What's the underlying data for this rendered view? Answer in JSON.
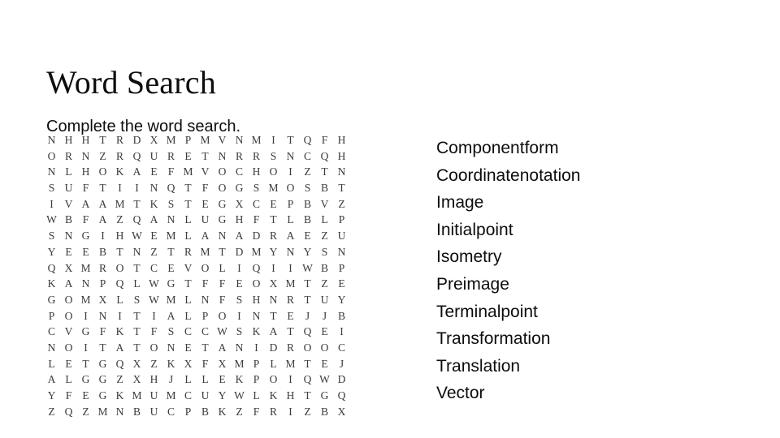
{
  "slide": {
    "title": "Word Search",
    "subtitle": "Complete the word search.",
    "background_color": "#ffffff",
    "text_color": "#0d0d0d",
    "grid_text_color": "#3b3b3b"
  },
  "puzzle": {
    "rows": 18,
    "columns": 18,
    "grid": [
      [
        "N",
        "H",
        "H",
        "T",
        "R",
        "D",
        "X",
        "M",
        "P",
        "M",
        "V",
        "N",
        "M",
        "I",
        "T",
        "Q",
        "F",
        "H"
      ],
      [
        "O",
        "R",
        "N",
        "Z",
        "R",
        "Q",
        "U",
        "R",
        "E",
        "T",
        "N",
        "R",
        "R",
        "S",
        "N",
        "C",
        "Q",
        "H"
      ],
      [
        "N",
        "L",
        "H",
        "O",
        "K",
        "A",
        "E",
        "F",
        "M",
        "V",
        "O",
        "C",
        "H",
        "O",
        "I",
        "Z",
        "T",
        "N"
      ],
      [
        "S",
        "U",
        "F",
        "T",
        "I",
        "I",
        "N",
        "Q",
        "T",
        "F",
        "O",
        "G",
        "S",
        "M",
        "O",
        "S",
        "B",
        "T"
      ],
      [
        "I",
        "V",
        "A",
        "A",
        "M",
        "T",
        "K",
        "S",
        "T",
        "E",
        "G",
        "X",
        "C",
        "E",
        "P",
        "B",
        "V",
        "Z"
      ],
      [
        "W",
        "B",
        "F",
        "A",
        "Z",
        "Q",
        "A",
        "N",
        "L",
        "U",
        "G",
        "H",
        "F",
        "T",
        "L",
        "B",
        "L",
        "P"
      ],
      [
        "S",
        "N",
        "G",
        "I",
        "H",
        "W",
        "E",
        "M",
        "L",
        "A",
        "N",
        "A",
        "D",
        "R",
        "A",
        "E",
        "Z",
        "U"
      ],
      [
        "Y",
        "E",
        "E",
        "B",
        "T",
        "N",
        "Z",
        "T",
        "R",
        "M",
        "T",
        "D",
        "M",
        "Y",
        "N",
        "Y",
        "S",
        "N"
      ],
      [
        "Q",
        "X",
        "M",
        "R",
        "O",
        "T",
        "C",
        "E",
        "V",
        "O",
        "L",
        "I",
        "Q",
        "I",
        "I",
        "W",
        "B",
        "P"
      ],
      [
        "K",
        "A",
        "N",
        "P",
        "Q",
        "L",
        "W",
        "G",
        "T",
        "F",
        "F",
        "E",
        "O",
        "X",
        "M",
        "T",
        "Z",
        "E"
      ],
      [
        "G",
        "O",
        "M",
        "X",
        "L",
        "S",
        "W",
        "M",
        "L",
        "N",
        "F",
        "S",
        "H",
        "N",
        "R",
        "T",
        "U",
        "Y"
      ],
      [
        "P",
        "O",
        "I",
        "N",
        "I",
        "T",
        "I",
        "A",
        "L",
        "P",
        "O",
        "I",
        "N",
        "T",
        "E",
        "J",
        "J",
        "B"
      ],
      [
        "C",
        "V",
        "G",
        "F",
        "K",
        "T",
        "F",
        "S",
        "C",
        "C",
        "W",
        "S",
        "K",
        "A",
        "T",
        "Q",
        "E",
        "I"
      ],
      [
        "N",
        "O",
        "I",
        "T",
        "A",
        "T",
        "O",
        "N",
        "E",
        "T",
        "A",
        "N",
        "I",
        "D",
        "R",
        "O",
        "O",
        "C"
      ],
      [
        "L",
        "E",
        "T",
        "G",
        "Q",
        "X",
        "Z",
        "K",
        "X",
        "F",
        "X",
        "M",
        "P",
        "L",
        "M",
        "T",
        "E",
        "J"
      ],
      [
        "A",
        "L",
        "G",
        "G",
        "Z",
        "X",
        "H",
        "J",
        "L",
        "L",
        "E",
        "K",
        "P",
        "O",
        "I",
        "Q",
        "W",
        "D"
      ],
      [
        "Y",
        "F",
        "E",
        "G",
        "K",
        "M",
        "U",
        "M",
        "C",
        "U",
        "Y",
        "W",
        "L",
        "K",
        "H",
        "T",
        "G",
        "Q"
      ],
      [
        "Z",
        "Q",
        "Z",
        "M",
        "N",
        "B",
        "U",
        "C",
        "P",
        "B",
        "K",
        "Z",
        "F",
        "R",
        "I",
        "Z",
        "B",
        "X"
      ]
    ]
  },
  "word_list": {
    "words": [
      "Componentform",
      "Coordinatenotation",
      "Image",
      "Initialpoint",
      "Isometry",
      "Preimage",
      "Terminalpoint",
      "Transformation",
      "Translation",
      "Vector"
    ]
  }
}
